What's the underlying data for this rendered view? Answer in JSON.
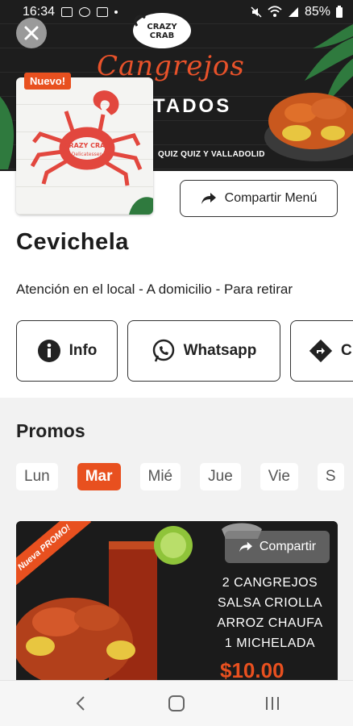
{
  "status_bar": {
    "time": "16:34",
    "battery": "85%"
  },
  "hero": {
    "headline_top": "Cangrejos",
    "headline_bottom": "TADOS",
    "address": "QUIZ QUIZ Y VALLADOLID",
    "logo_text": "CRAZY CRAB",
    "logo_sub": "Delicatessen"
  },
  "logo": {
    "badge": "Nuevo!",
    "logo_text": "CRAZY CRAB",
    "logo_sub": "Delicatessen"
  },
  "share_menu": {
    "label": "Compartir Menú"
  },
  "restaurant": {
    "name": "Cevichela",
    "service_modes": "Atención en el local - A domicilio - Para retirar"
  },
  "actions": [
    {
      "label": "Info",
      "icon": "info-icon"
    },
    {
      "label": "Whatsapp",
      "icon": "whatsapp-icon"
    },
    {
      "label": "C",
      "icon": "directions-icon"
    }
  ],
  "promos": {
    "title": "Promos",
    "days": [
      "Lun",
      "Mar",
      "Mié",
      "Jue",
      "Vie",
      "S"
    ],
    "active_day": "Mar",
    "card": {
      "ribbon": "Nueva PROMO!",
      "share_label": "Compartir",
      "lines": [
        "2 CANGREJOS",
        "SALSA CRIOLLA",
        "ARROZ CHAUFA",
        "1 MICHELADA"
      ],
      "price": "$10.00"
    }
  },
  "colors": {
    "accent": "#e8501f",
    "dark": "#1c1c1c"
  }
}
